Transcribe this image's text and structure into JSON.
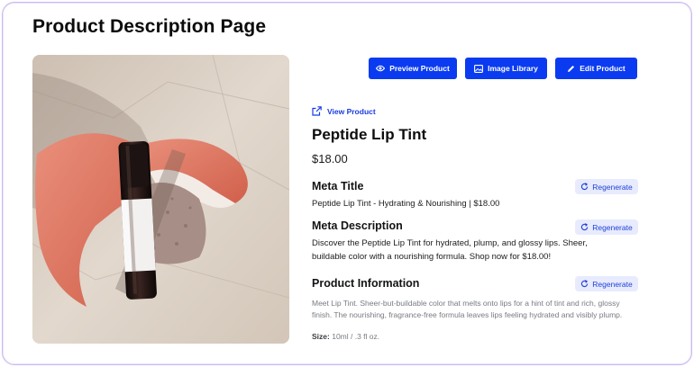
{
  "page": {
    "title": "Product Description Page"
  },
  "toolbar": {
    "preview_label": "Preview Product",
    "library_label": "Image Library",
    "edit_label": "Edit Product"
  },
  "product": {
    "view_link": "View Product",
    "name": "Peptide Lip Tint",
    "price": "$18.00"
  },
  "sections": {
    "meta_title": {
      "heading": "Meta Title",
      "text": "Peptide Lip Tint - Hydrating & Nourishing | $18.00",
      "button": "Regenerate"
    },
    "meta_description": {
      "heading": "Meta Description",
      "line1": "Discover the Peptide Lip Tint for hydrated, plump, and glossy lips. Sheer,",
      "line2": "buildable color with a nourishing formula. Shop now for $18.00!",
      "button": "Regenerate"
    },
    "product_information": {
      "heading": "Product Information",
      "text": "Meet Lip Tint. Sheer-but-buildable color that melts onto lips for a hint of tint and rich, glossy finish. The nourishing, fragrance-free formula leaves lips feeling hydrated and visibly plump.",
      "size_label": "Size:",
      "size_value": "10ml / .3 fl oz.",
      "button": "Regenerate"
    }
  },
  "colors": {
    "primary_button": "#0b3bf0",
    "regenerate_bg": "#e7ebfd",
    "link": "#1a3be0"
  },
  "icons": {
    "preview": "eye-icon",
    "library": "image-icon",
    "edit": "pencil-icon",
    "view": "external-link-icon",
    "regenerate": "refresh-icon"
  }
}
